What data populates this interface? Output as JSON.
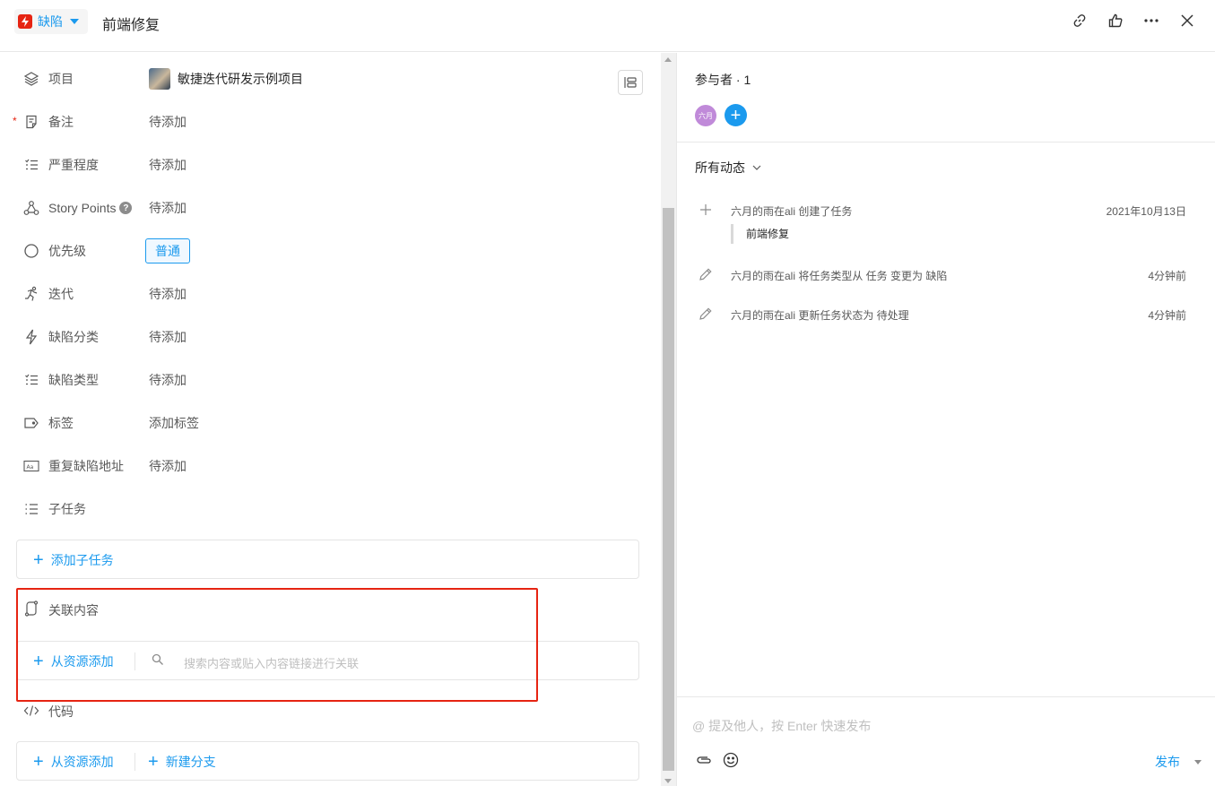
{
  "header": {
    "type_label": "缺陷",
    "title": "前端修复"
  },
  "fields": {
    "project": {
      "label": "项目",
      "value": "敏捷迭代研发示例项目"
    },
    "note": {
      "label": "备注",
      "value": "待添加"
    },
    "severity": {
      "label": "严重程度",
      "value": "待添加"
    },
    "story_points": {
      "label": "Story Points",
      "help": "?",
      "value": "待添加"
    },
    "priority": {
      "label": "优先级",
      "value": "普通"
    },
    "sprint": {
      "label": "迭代",
      "value": "待添加"
    },
    "bug_category": {
      "label": "缺陷分类",
      "value": "待添加"
    },
    "bug_type": {
      "label": "缺陷类型",
      "value": "待添加"
    },
    "tags": {
      "label": "标签",
      "value": "添加标签"
    },
    "dup_url": {
      "label": "重复缺陷地址",
      "value": "待添加"
    },
    "subtasks": {
      "label": "子任务"
    }
  },
  "subtask_box": {
    "add_label": "添加子任务"
  },
  "related": {
    "label": "关联内容",
    "add_label": "从资源添加",
    "search_placeholder": "搜索内容或贴入内容链接进行关联"
  },
  "code": {
    "label": "代码",
    "add_label": "从资源添加",
    "branch_label": "新建分支"
  },
  "participants": {
    "label": "参与者 · 1",
    "avatar_text": "六月"
  },
  "activity": {
    "filter_label": "所有动态",
    "items": [
      {
        "text": "六月的雨在ali 创建了任务",
        "time": "2021年10月13日",
        "quote": "前端修复",
        "icon": "plus-icon"
      },
      {
        "text": "六月的雨在ali 将任务类型从 任务 变更为 缺陷",
        "time": "4分钟前",
        "icon": "pencil-icon"
      },
      {
        "text": "六月的雨在ali 更新任务状态为 待处理",
        "time": "4分钟前",
        "icon": "pencil-icon"
      }
    ]
  },
  "comment": {
    "placeholder": "@ 提及他人，按 Enter 快速发布",
    "publish_label": "发布"
  },
  "colors": {
    "accent": "#1b9aee",
    "bug_red": "#e62412",
    "highlight": "#e62412"
  }
}
